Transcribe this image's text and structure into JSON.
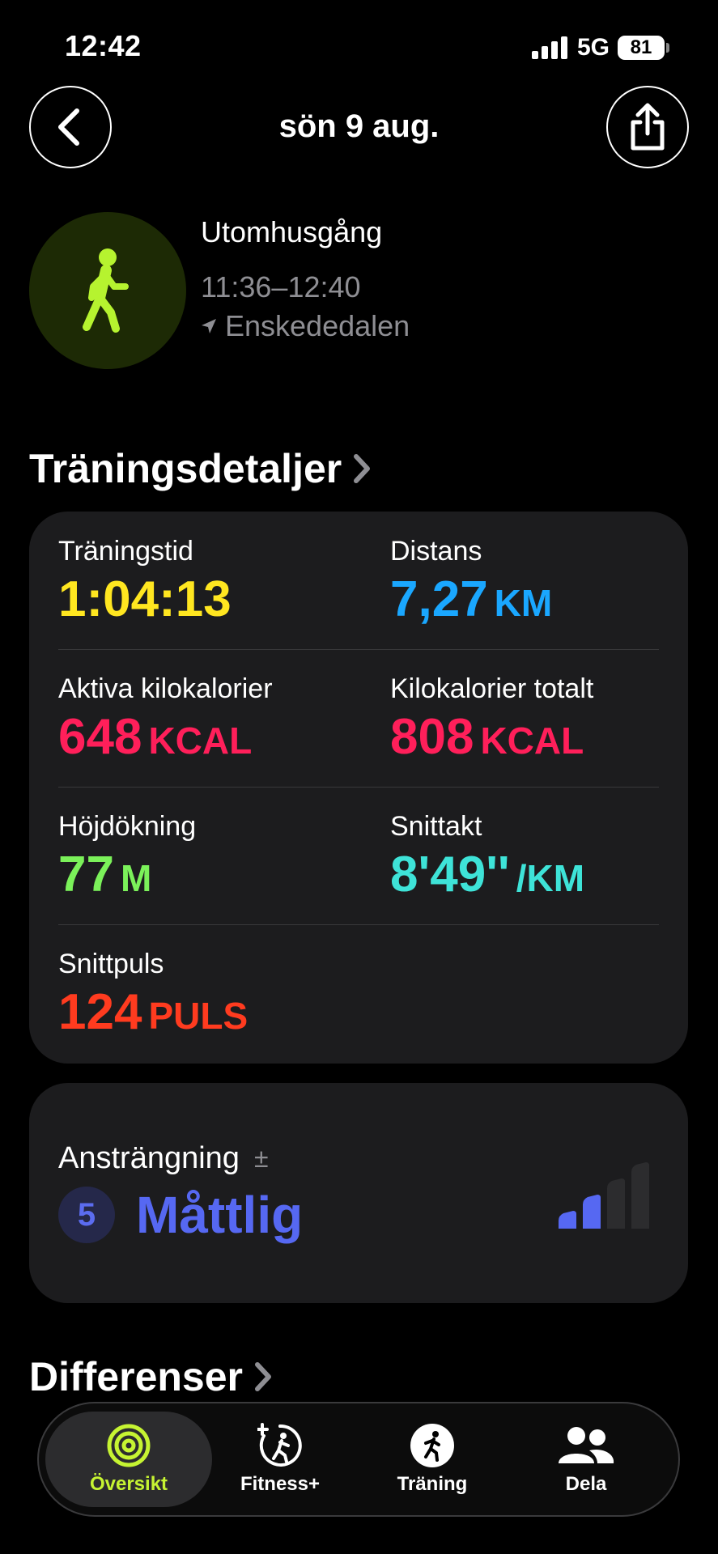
{
  "status": {
    "time": "12:42",
    "network": "5G",
    "battery": "81"
  },
  "header": {
    "title": "sön 9 aug."
  },
  "activity": {
    "name": "Utomhusgång",
    "time_range": "11:36–12:40",
    "location": "Enskededalen"
  },
  "sections": {
    "details_title": "Träningsdetaljer",
    "differences_title": "Differenser"
  },
  "metrics": {
    "duration": {
      "label": "Träningstid",
      "value": "1:04:13",
      "unit": "",
      "color": "#ffe620"
    },
    "distance": {
      "label": "Distans",
      "value": "7,27",
      "unit": "KM",
      "color": "#1aa7ff"
    },
    "active_kcal": {
      "label": "Aktiva kilokalorier",
      "value": "648",
      "unit": "KCAL",
      "color": "#ff1f5a"
    },
    "total_kcal": {
      "label": "Kilokalorier totalt",
      "value": "808",
      "unit": "KCAL",
      "color": "#ff1f5a"
    },
    "elevation": {
      "label": "Höjdökning",
      "value": "77",
      "unit": "M",
      "color": "#7bf15a"
    },
    "pace": {
      "label": "Snittakt",
      "value": "8'49''",
      "unit": "/KM",
      "color": "#3ee3d8"
    },
    "heart_rate": {
      "label": "Snittpuls",
      "value": "124",
      "unit": "PULS",
      "color": "#ff3b1f"
    }
  },
  "effort": {
    "label": "Ansträngning",
    "adjust_symbol": "±",
    "score": "5",
    "level": "Måttlig",
    "color": "#5668f2",
    "bars_filled": 2,
    "bars_total": 4
  },
  "tabs": [
    {
      "label": "Översikt",
      "icon": "activity-rings-icon",
      "active": true
    },
    {
      "label": "Fitness+",
      "icon": "fitness-plus-icon",
      "active": false
    },
    {
      "label": "Träning",
      "icon": "running-icon",
      "active": false
    },
    {
      "label": "Dela",
      "icon": "people-icon",
      "active": false
    }
  ],
  "colors": {
    "accent": "#c6f432",
    "card": "#1c1c1e",
    "secondary_text": "#8e8e93"
  }
}
